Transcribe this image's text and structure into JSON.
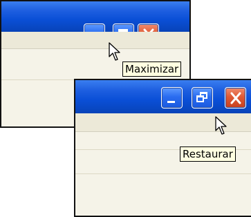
{
  "window_top": {
    "buttons": {
      "minimize_icon": "minimize-icon",
      "maximize_icon": "maximize-icon",
      "close_icon": "close-icon"
    },
    "tooltip": "Maximizar"
  },
  "window_bottom": {
    "buttons": {
      "minimize_icon": "minimize-icon",
      "restore_icon": "restore-icon",
      "close_icon": "close-icon"
    },
    "tooltip": "Restaurar"
  },
  "colors": {
    "titlebar": "#0a4fd6",
    "close_button": "#df5a35",
    "tooltip_bg": "#ffffe1"
  }
}
